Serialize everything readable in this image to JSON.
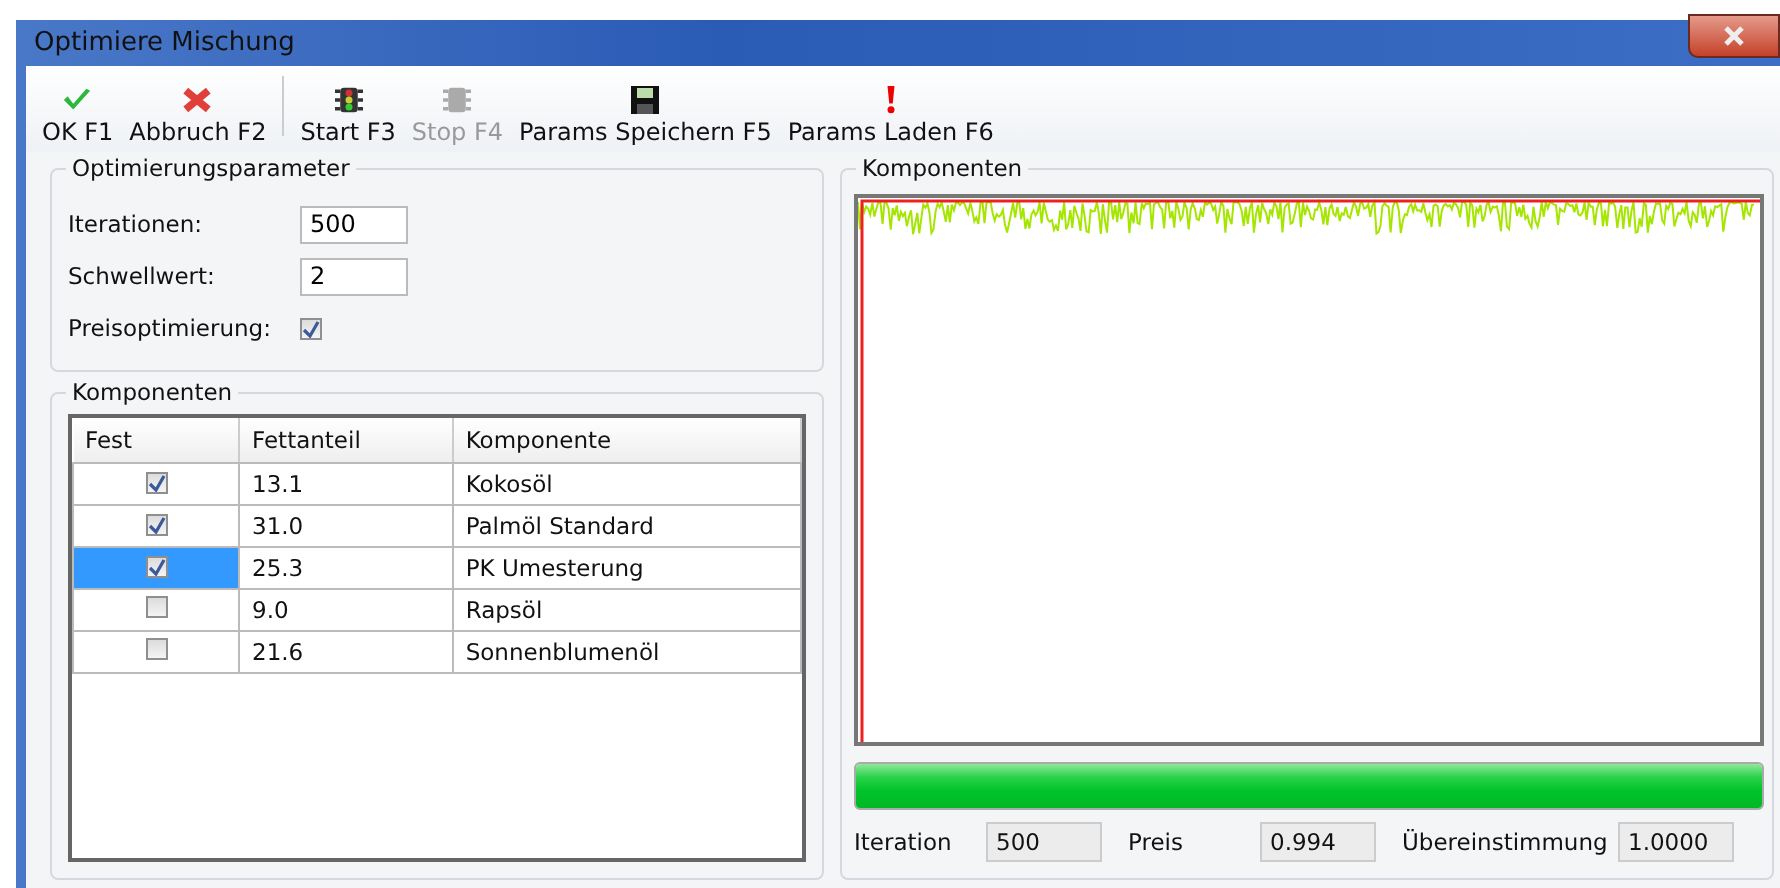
{
  "window": {
    "title": "Optimiere Mischung"
  },
  "toolbar": [
    {
      "label": "OK F1",
      "kind": "confirm",
      "disabled": false
    },
    {
      "label": "Abbruch F2",
      "kind": "cancel",
      "disabled": false
    },
    {
      "label": "Start F3",
      "kind": "start",
      "disabled": false
    },
    {
      "label": "Stop F4",
      "kind": "stop",
      "disabled": true
    },
    {
      "label": "Params Speichern F5",
      "kind": "save",
      "disabled": false
    },
    {
      "label": "Params Laden F6",
      "kind": "load",
      "disabled": false
    }
  ],
  "parameters": {
    "title": "Optimierungsparameter",
    "fields": [
      {
        "label": "Iterationen:",
        "kind": "text",
        "value": "500"
      },
      {
        "label": "Schwellwert:",
        "kind": "text",
        "value": "2"
      },
      {
        "label": "Preisoptimierung:",
        "kind": "checkbox",
        "checked": true
      }
    ]
  },
  "components": {
    "title": "Komponenten",
    "columns": [
      "Fest",
      "Fettanteil",
      "Komponente"
    ],
    "rows": [
      {
        "fixed": true,
        "share": "13.1",
        "name": "Kokosöl",
        "selected": false
      },
      {
        "fixed": true,
        "share": "31.0",
        "name": "Palmöl Standard",
        "selected": false
      },
      {
        "fixed": true,
        "share": "25.3",
        "name": "PK Umesterung",
        "selected": true
      },
      {
        "fixed": false,
        "share": "9.0",
        "name": "Rapsöl",
        "selected": false
      },
      {
        "fixed": false,
        "share": "21.6",
        "name": "Sonnenblumenöl",
        "selected": false
      }
    ]
  },
  "result": {
    "title": "Komponenten",
    "progress": {
      "level": 1.0
    },
    "stats": [
      {
        "label": "Iteration",
        "value": "500"
      },
      {
        "label": "Preis",
        "value": "0.994"
      },
      {
        "label": "Übereinstimmung",
        "value": "1.0000"
      }
    ]
  }
}
